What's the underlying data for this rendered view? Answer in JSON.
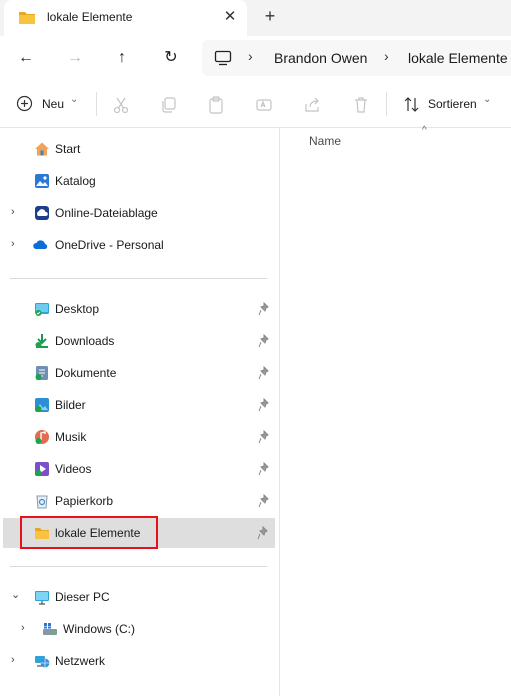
{
  "tab": {
    "title": "lokale Elemente",
    "close": "✕",
    "new": "+"
  },
  "nav_buttons": {
    "back": "←",
    "forward": "→",
    "up": "↑",
    "refresh": "↻"
  },
  "address": {
    "crumbs": [
      "Brandon Owen",
      "lokale Elemente"
    ],
    "separator": "›"
  },
  "toolbar": {
    "new_label": "Neu",
    "sort_label": "Sortieren",
    "dropdown": "⌄"
  },
  "sidebar": {
    "top_items": [
      {
        "label": "Start",
        "icon": "home-icon",
        "chevron": ""
      },
      {
        "label": "Katalog",
        "icon": "gallery-icon",
        "chevron": ""
      },
      {
        "label": "Online-Dateiablage",
        "icon": "cloud-storage-icon",
        "chevron": "›"
      },
      {
        "label": "OneDrive - Personal",
        "icon": "onedrive-icon",
        "chevron": "›"
      }
    ],
    "quick_access": [
      {
        "label": "Desktop",
        "icon": "desktop-icon"
      },
      {
        "label": "Downloads",
        "icon": "downloads-icon"
      },
      {
        "label": "Dokumente",
        "icon": "documents-icon"
      },
      {
        "label": "Bilder",
        "icon": "pictures-icon"
      },
      {
        "label": "Musik",
        "icon": "music-icon"
      },
      {
        "label": "Videos",
        "icon": "videos-icon"
      },
      {
        "label": "Papierkorb",
        "icon": "recycle-bin-icon"
      },
      {
        "label": "lokale Elemente",
        "icon": "folder-icon",
        "selected": true
      }
    ],
    "bottom_items": [
      {
        "label": "Dieser PC",
        "icon": "this-pc-icon",
        "chevron": "⌄"
      },
      {
        "label": "Windows (C:)",
        "icon": "drive-icon",
        "chevron": "›"
      },
      {
        "label": "Netzwerk",
        "icon": "network-icon",
        "chevron": "›"
      }
    ]
  },
  "content": {
    "column_name": "Name",
    "sort_caret": "^"
  },
  "colors": {
    "selection": "#dedede",
    "highlight_border": "#e4121b",
    "folder": "#f8c440",
    "accent": "#0067c0"
  }
}
